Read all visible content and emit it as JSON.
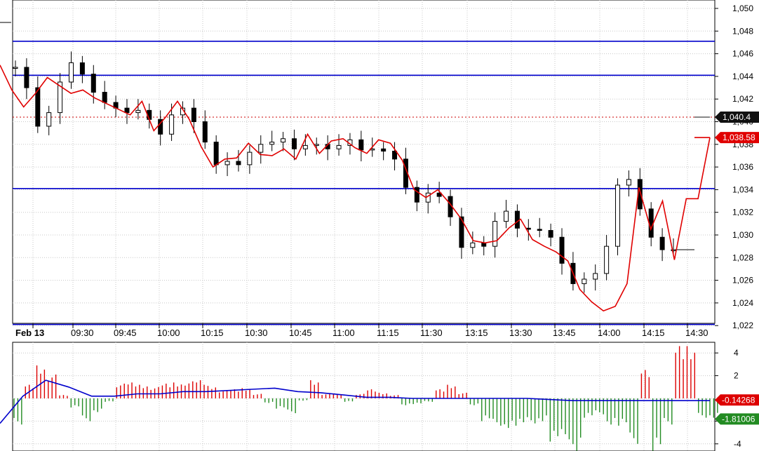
{
  "chart_data": [
    {
      "type": "candlestick",
      "panel": "price",
      "ylim": [
        1021.5,
        1050.5
      ],
      "y_ticks": [
        "1,050",
        "1,048",
        "1,046",
        "1,044",
        "1,042",
        "1,040",
        "1,038",
        "1,036",
        "1,034",
        "1,032",
        "1,030",
        "1,028",
        "1,026",
        "1,024",
        "1,022"
      ],
      "y_tick_values": [
        1050,
        1048,
        1046,
        1044,
        1042,
        1040,
        1038,
        1036,
        1034,
        1032,
        1030,
        1028,
        1026,
        1024,
        1022
      ],
      "x_labels": [
        "Feb 13",
        "09:30",
        "09:45",
        "10:00",
        "10:15",
        "10:30",
        "10:45",
        "11:00",
        "11:15",
        "11:30",
        "13:15",
        "13:30",
        "13:45",
        "14:00",
        "14:15",
        "14:30"
      ],
      "horizontal_lines": [
        1047.1,
        1044.1,
        1034.1,
        1022.1
      ],
      "horizontal_line_color": "#0000cc",
      "dotted_line": 1040.4,
      "dotted_line_color": "#cc0000",
      "last_price_label": "1,040.4",
      "last_price_color": "#111111",
      "line_label": "1,038.58",
      "line_color": "#e00000",
      "candle_close_series": [
        1044.8,
        1043.0,
        1039.6,
        1040.8,
        1043.5,
        1045.2,
        1044.2,
        1042.6,
        1041.7,
        1041.2,
        1040.8,
        1041.0,
        1040.2,
        1038.9,
        1040.6,
        1041.2,
        1040.0,
        1038.2,
        1036.2,
        1036.5,
        1036.2,
        1037.3,
        1038.0,
        1038.2,
        1038.5,
        1037.6,
        1037.9,
        1038.0,
        1037.6,
        1037.9,
        1038.4,
        1037.5,
        1037.6,
        1037.4,
        1036.7,
        1034.2,
        1032.9,
        1033.7,
        1033.4,
        1031.6,
        1028.9,
        1029.3,
        1029.0,
        1031.2,
        1032.1,
        1030.6,
        1030.5,
        1030.4,
        1029.8,
        1027.5,
        1025.7,
        1026.1,
        1026.6,
        1029.0,
        1034.4,
        1034.9,
        1032.3,
        1029.8,
        1028.7,
        1028.7
      ],
      "line_series": [
        1045.0,
        1042.8,
        1041.3,
        1042.5,
        1043.9,
        1043.2,
        1042.5,
        1042.8,
        1042.1,
        1041.6,
        1041.1,
        1040.6,
        1041.8,
        1039.2,
        1040.4,
        1041.8,
        1040.2,
        1037.8,
        1036.0,
        1036.7,
        1036.8,
        1038.1,
        1037.1,
        1037.0,
        1037.6,
        1036.7,
        1038.9,
        1037.2,
        1038.3,
        1038.5,
        1037.7,
        1037.2,
        1038.4,
        1038.1,
        1036.6,
        1034.0,
        1033.3,
        1034.0,
        1032.8,
        1031.4,
        1029.5,
        1029.3,
        1029.5,
        1030.6,
        1031.4,
        1029.6,
        1029.0,
        1028.5,
        1027.7,
        1025.2,
        1024.1,
        1023.3,
        1023.7,
        1025.7,
        1034.2,
        1030.5,
        1033.0,
        1027.8,
        1033.2,
        1033.2,
        1038.6
      ]
    },
    {
      "type": "bar",
      "panel": "oscillator",
      "ylim": [
        -5,
        5
      ],
      "y_ticks": [
        "4",
        "2",
        "-2",
        "-4"
      ],
      "y_tick_values": [
        4,
        2,
        -2,
        -4
      ],
      "positive_color": "#dd0000",
      "negative_color": "#228b22",
      "signal_color": "#0000cc",
      "histogram_values": [
        -2.3,
        1.2,
        2.9,
        2.1,
        0.3,
        -0.8,
        -2.0,
        -1.2,
        -0.3,
        1.3,
        1.4,
        1.2,
        1.0,
        1.3,
        1.4,
        1.5,
        1.6,
        1.1,
        0.7,
        0.8,
        0.9,
        0.4,
        -0.4,
        -0.9,
        -1.3,
        -0.2,
        1.6,
        0.4,
        0.4,
        -0.3,
        0.4,
        0.8,
        0.5,
        0.3,
        -0.6,
        -0.5,
        -0.3,
        0.8,
        1.2,
        0.5,
        -0.6,
        -2.0,
        -2.4,
        -2.6,
        -2.4,
        -2.2,
        -2.0,
        -3.8,
        -3.6,
        -4.6,
        -1.7,
        -1.4,
        -2.3,
        -2.4,
        -4.0,
        2.5,
        -4.6,
        -2.3,
        4.6,
        4.6,
        -1.7,
        -1.7
      ],
      "signal_values": [
        -2.2,
        0.2,
        1.6,
        1.0,
        0.2,
        0.2,
        0.4,
        0.4,
        0.6,
        0.6,
        0.7,
        0.8,
        0.9,
        0.6,
        0.5,
        0.3,
        0.1,
        0.1,
        0.0,
        0.0,
        0.0,
        0.0,
        0.0,
        0.0,
        -0.1,
        -0.2,
        -0.2,
        -0.2,
        -0.2,
        -0.2,
        -0.2,
        -0.2
      ],
      "last_value_label": "-0.14268",
      "last_value_color": "#dd0000",
      "signal_label": "-1.81006",
      "signal_label_color": "#228b22"
    }
  ]
}
